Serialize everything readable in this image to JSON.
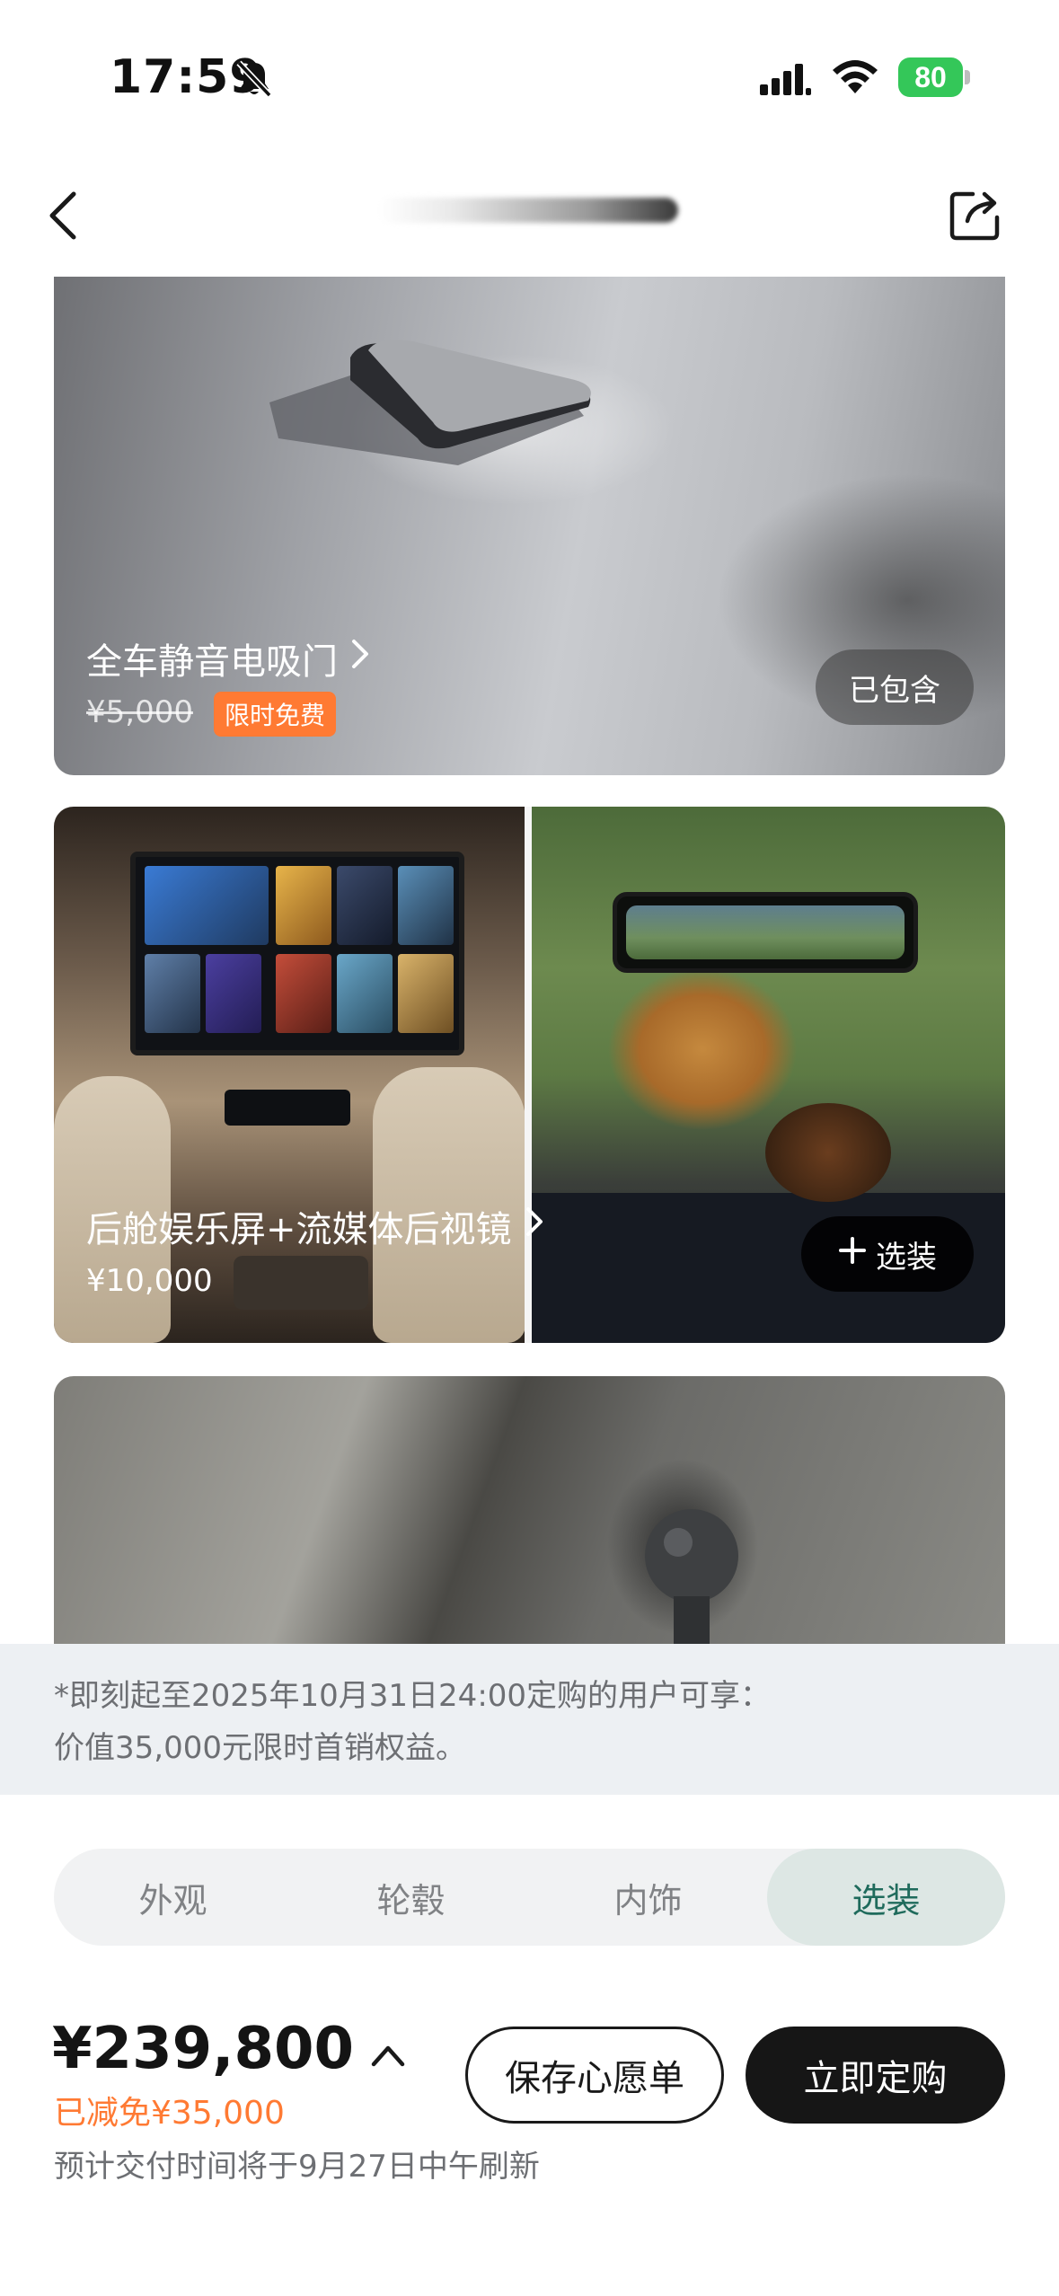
{
  "status_bar": {
    "time": "17:59",
    "battery": "80"
  },
  "nav": {
    "title": ""
  },
  "cards": [
    {
      "title": "全车静音电吸门",
      "original_price": "¥5,000",
      "badge": "限时免费",
      "status": "已包含"
    },
    {
      "title": "后舱娱乐屏+流媒体后视镜",
      "price": "¥10,000",
      "action": "选装"
    }
  ],
  "notice": {
    "line1": "*即刻起至2025年10月31日24:00定购的用户可享：",
    "line2": "价值35,000元限时首销权益。"
  },
  "tabs": [
    {
      "label": "外观",
      "active": false
    },
    {
      "label": "轮毂",
      "active": false
    },
    {
      "label": "内饰",
      "active": false
    },
    {
      "label": "选装",
      "active": true
    }
  ],
  "footer": {
    "price": "¥239,800",
    "discount": "已减免¥35,000",
    "delivery_note": "预计交付时间将于9月27日中午刷新",
    "wishlist_label": "保存心愿单",
    "order_label": "立即定购"
  },
  "colors": {
    "accent_orange": "#ff7a33",
    "active_tab_bg": "#dde7e4",
    "active_tab_text": "#1f6b5c",
    "primary_button": "#161616"
  }
}
